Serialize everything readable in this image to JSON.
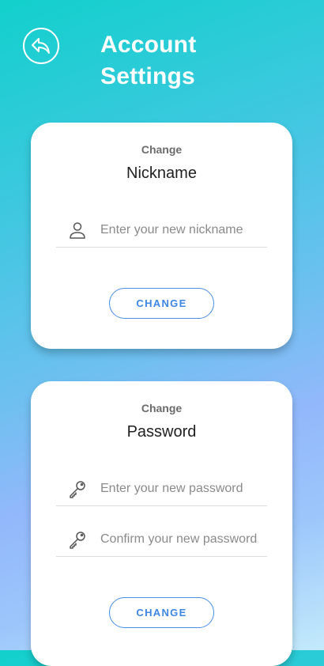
{
  "header": {
    "title_line1": "Account",
    "title_line2": "Settings",
    "back_icon": "reply-arrow-icon"
  },
  "nickname_card": {
    "eyebrow": "Change",
    "heading": "Nickname",
    "field": {
      "icon": "person-icon",
      "placeholder": "Enter your new nickname",
      "value": ""
    },
    "button_label": "CHANGE"
  },
  "password_card": {
    "eyebrow": "Change",
    "heading": "Password",
    "fields": [
      {
        "icon": "key-icon",
        "placeholder": "Enter your new password",
        "value": ""
      },
      {
        "icon": "key-icon",
        "placeholder": "Confirm your new password",
        "value": ""
      }
    ],
    "button_label": "CHANGE"
  },
  "colors": {
    "accent": "#3d86e3",
    "gradient_top": "#12d0cc",
    "gradient_mid": "#93b8fb",
    "gradient_bottom": "#c3eafb"
  }
}
